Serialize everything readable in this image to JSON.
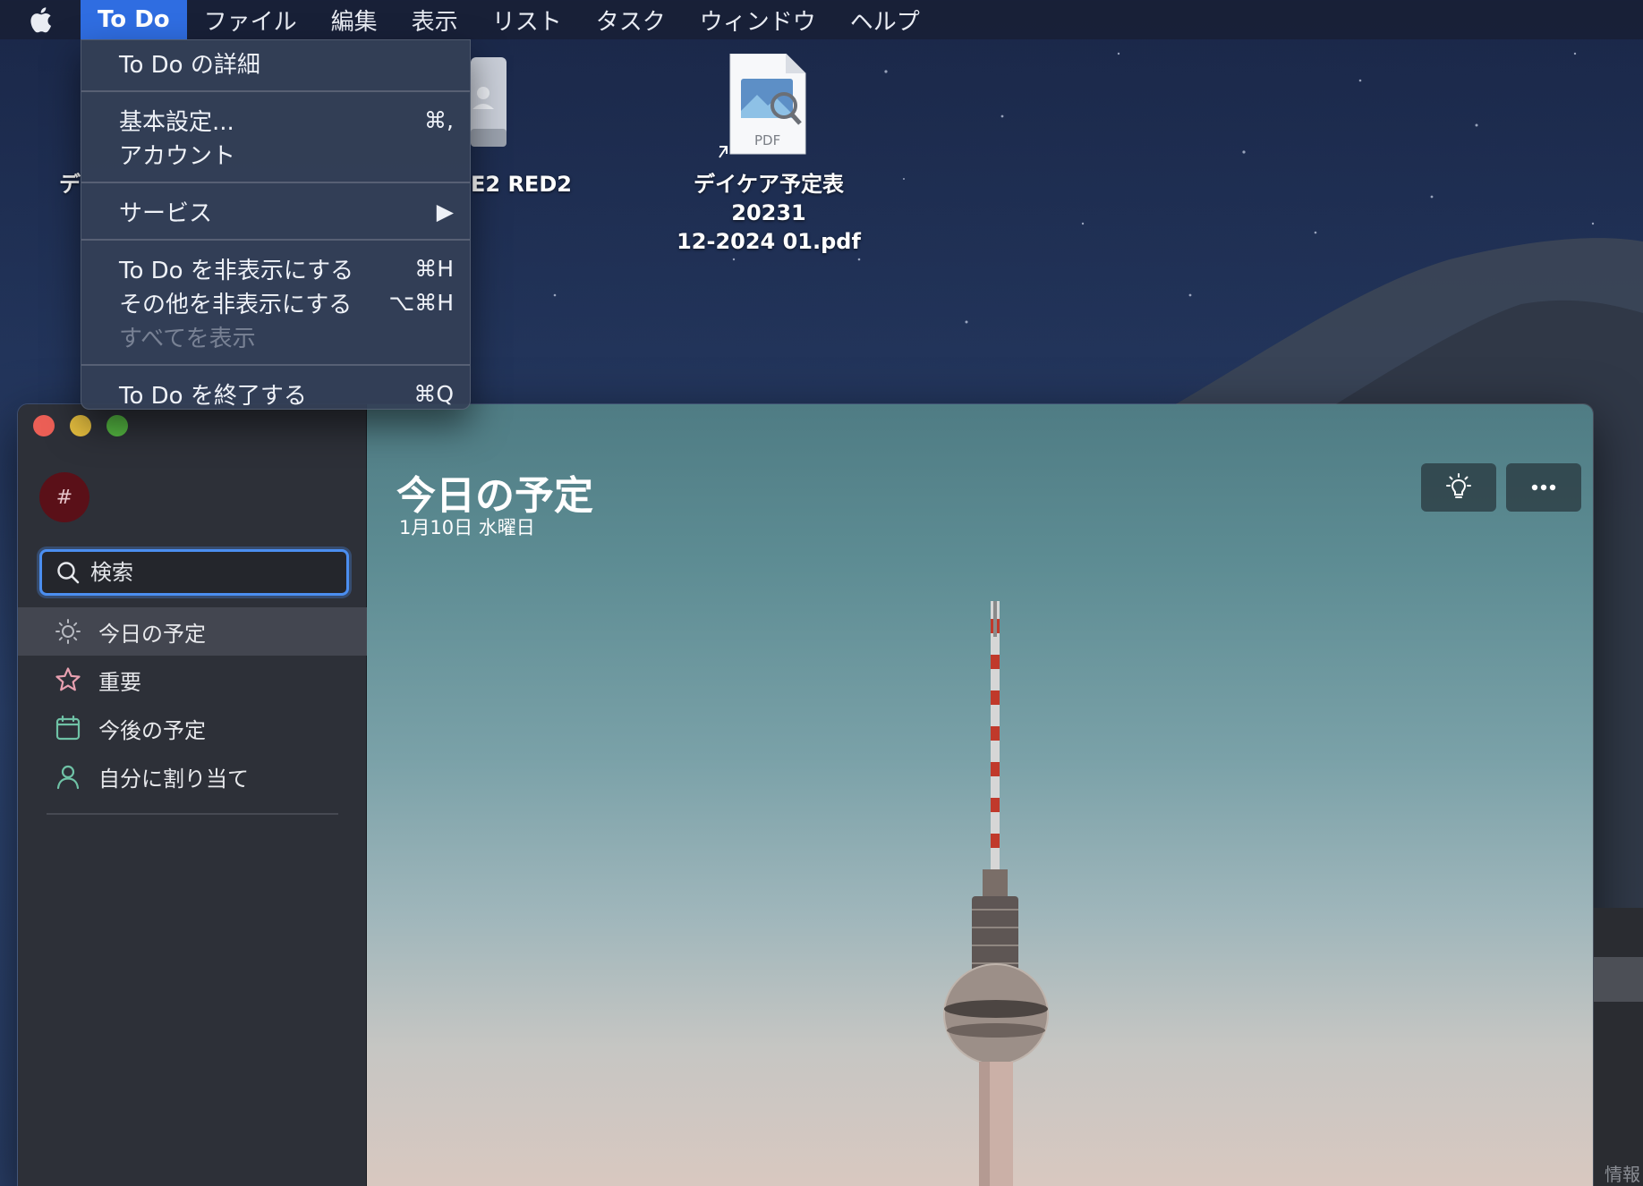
{
  "menubar": {
    "apple_icon": "apple-icon",
    "app_name": "To Do",
    "items": [
      "ファイル",
      "編集",
      "表示",
      "リスト",
      "タスク",
      "ウィンドウ",
      "ヘルプ"
    ]
  },
  "app_menu": {
    "about": "To Do の詳細",
    "preferences": "基本設定...",
    "preferences_shortcut": "⌘,",
    "accounts": "アカウント",
    "services": "サービス",
    "services_arrow": "▶",
    "hide": "To Do を非表示にする",
    "hide_shortcut": "⌘H",
    "hide_others": "その他を非表示にする",
    "hide_others_shortcut": "⌥⌘H",
    "show_all": "すべてを表示",
    "quit": "To Do を終了する",
    "quit_shortcut": "⌘Q"
  },
  "desktop": {
    "left_label_fragment": "デ",
    "drive_label_fragment": "E2 RED2",
    "pdf_file_label_line1": "デイケア予定表20231",
    "pdf_file_label_line2": "12-2024 01.pdf",
    "pdf_badge": "PDF"
  },
  "sidebar": {
    "avatar_text": "#",
    "search_placeholder": "検索",
    "items": [
      {
        "label": "今日の予定",
        "icon": "sun-icon",
        "active": true
      },
      {
        "label": "重要",
        "icon": "star-icon"
      },
      {
        "label": "今後の予定",
        "icon": "calendar-icon"
      },
      {
        "label": "自分に割り当て",
        "icon": "person-icon"
      }
    ]
  },
  "main": {
    "title": "今日の予定",
    "date": "1月10日 水曜日",
    "suggestions_icon": "lightbulb-icon",
    "more_icon": "more-icon"
  },
  "background_window": {
    "partial_label": "情報"
  },
  "colors": {
    "menu_highlight": "#2f6de1",
    "sidebar_bg": "#2d3038",
    "search_focus": "#4b8ef0",
    "star": "#e8a0b0",
    "calendar": "#6fc2a6",
    "person": "#6fc2a6"
  }
}
